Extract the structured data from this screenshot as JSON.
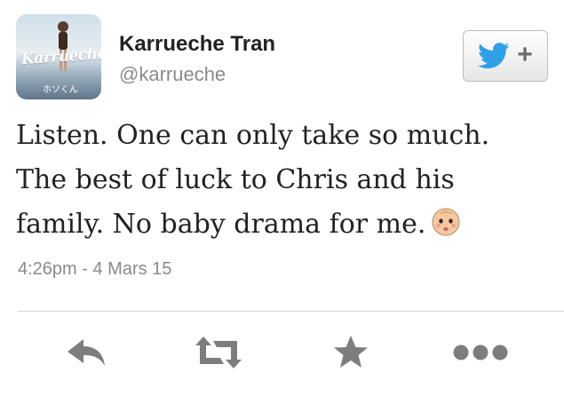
{
  "user": {
    "name": "Karrueche Tran",
    "handle": "@karrueche",
    "avatar_text": "Karrueche",
    "avatar_subtext": "ホソくん"
  },
  "follow_button": {
    "icon": "twitter-bird-icon",
    "plus": "+"
  },
  "tweet": {
    "lines": [
      "Listen. One can only take so much.",
      "The best of luck to Chris and his",
      "family. No baby drama for me."
    ],
    "emoji": "baby-face-icon"
  },
  "timestamp": "4:26pm - 4 Mars 15",
  "actions": [
    {
      "name": "reply",
      "icon": "reply-arrow-icon"
    },
    {
      "name": "retweet",
      "icon": "retweet-icon"
    },
    {
      "name": "favorite",
      "icon": "star-icon"
    },
    {
      "name": "more",
      "icon": "more-dots-icon"
    }
  ],
  "colors": {
    "twitter_blue": "#2fa0e6",
    "icon_gray": "#7d7d7d",
    "text": "#222222",
    "muted": "#8a8a8a"
  }
}
